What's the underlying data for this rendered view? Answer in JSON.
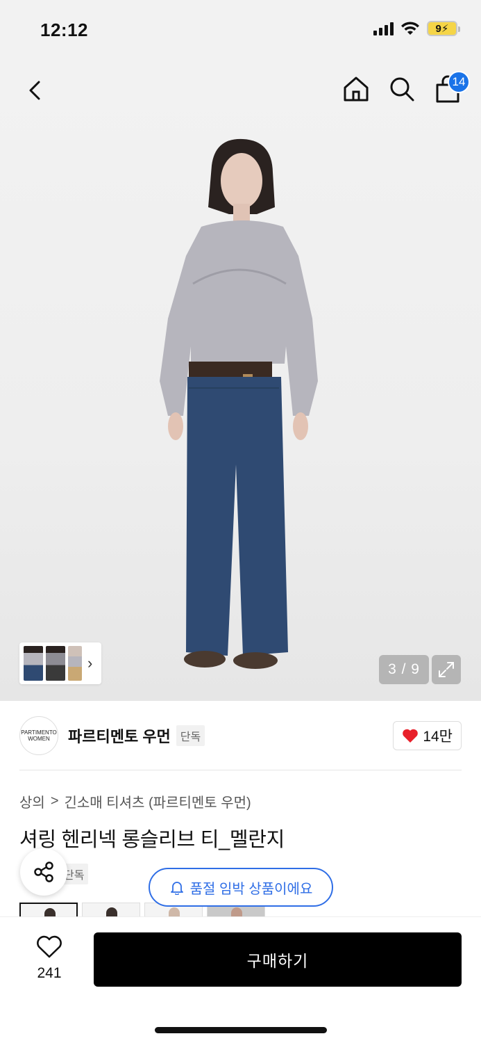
{
  "status_bar": {
    "time": "12:12",
    "battery": "9"
  },
  "nav": {
    "cart_count": "14"
  },
  "gallery": {
    "counter": "3 / 9"
  },
  "brand": {
    "logo_text_1": "PARTIMENTO",
    "logo_text_2": "WOMEN",
    "name": "파르티멘토 우먼",
    "tag": "단독",
    "likes": "14만"
  },
  "breadcrumb": {
    "category": "상의",
    "separator": ">",
    "subcategory": "긴소매 티셔츠 (파르티멘토 우먼)"
  },
  "product": {
    "title": "셔링 헨리넥 롱슬리브 티_멜란지",
    "tag": "단독"
  },
  "notice": {
    "soldout": "품절 임박 상품이에요"
  },
  "bottom": {
    "wish_count": "241",
    "buy_label": "구매하기"
  },
  "colors": {
    "accent_blue": "#2f6ee6",
    "badge_blue": "#1a73e8",
    "like_red": "#e8202a",
    "buy_black": "#000000"
  }
}
